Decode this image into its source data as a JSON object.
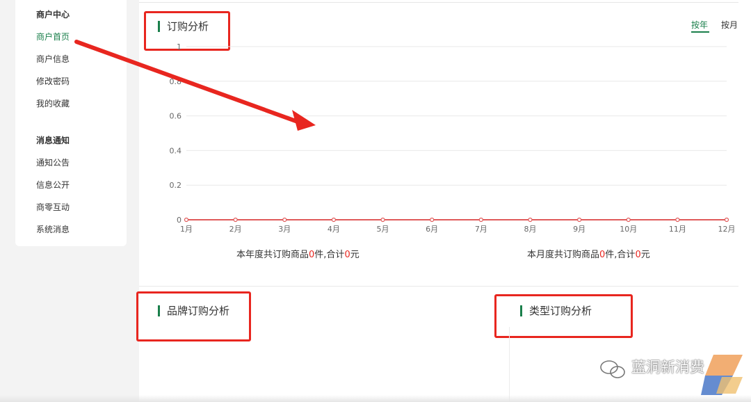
{
  "sidebar": {
    "groups": [
      {
        "title": "商户中心",
        "items": [
          "商户首页",
          "商户信息",
          "修改密码",
          "我的收藏"
        ]
      },
      {
        "title": "消息通知",
        "items": [
          "通知公告",
          "信息公开",
          "商零互动",
          "系统消息"
        ]
      }
    ],
    "active_item": "商户首页"
  },
  "order_analysis": {
    "title": "订购分析",
    "tabs": [
      "按年",
      "按月"
    ],
    "active_tab": "按年"
  },
  "summary": {
    "year_prefix": "本年度共订购商品",
    "year_count": "0",
    "year_mid": "件,合计",
    "year_amount": "0",
    "year_suffix": "元",
    "month_prefix": "本月度共订购商品",
    "month_count": "0",
    "month_mid": "件,合计",
    "month_amount": "0",
    "month_suffix": "元"
  },
  "brand_analysis": {
    "title": "品牌订购分析"
  },
  "type_analysis": {
    "title": "类型订购分析"
  },
  "watermark": {
    "text": "蓝洞新消费"
  },
  "colors": {
    "accent": "#1a7f4b",
    "line": "#e05a5a",
    "annotation": "#e8261f",
    "grid": "#e8e8e8"
  },
  "chart_data": {
    "type": "line",
    "categories": [
      "1月",
      "2月",
      "3月",
      "4月",
      "5月",
      "6月",
      "7月",
      "8月",
      "9月",
      "10月",
      "11月",
      "12月"
    ],
    "series": [
      {
        "values": [
          0,
          0,
          0,
          0,
          0,
          0,
          0,
          0,
          0,
          0,
          0,
          0
        ]
      }
    ],
    "yticks": [
      "0",
      "0.2",
      "0.4",
      "0.6",
      "0.8",
      "1"
    ],
    "ylim": [
      0,
      1
    ],
    "grid": true
  }
}
